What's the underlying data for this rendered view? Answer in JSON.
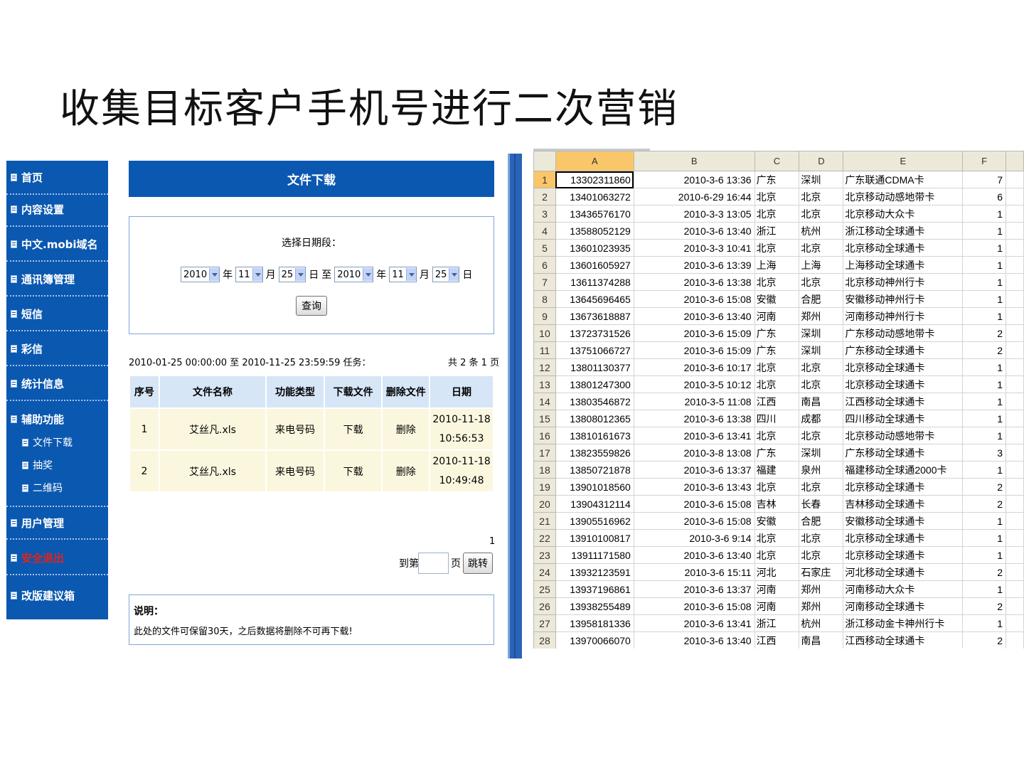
{
  "slide": {
    "title": "收集目标客户手机号进行二次营销"
  },
  "sidebar": {
    "items": [
      {
        "label": "首页"
      },
      {
        "label": "内容设置"
      },
      {
        "label": "中文.mobi域名"
      },
      {
        "label": "通讯簿管理"
      },
      {
        "label": "短信"
      },
      {
        "label": "彩信"
      },
      {
        "label": "统计信息"
      },
      {
        "label": "辅助功能"
      },
      {
        "label": "用户管理"
      },
      {
        "label": "安全退出"
      },
      {
        "label": "改版建议箱"
      }
    ],
    "sub_items": [
      {
        "label": "文件下载"
      },
      {
        "label": "抽奖"
      },
      {
        "label": "二维码"
      }
    ]
  },
  "content": {
    "header": "文件下载",
    "date_label": "选择日期段：",
    "from": {
      "year": "2010",
      "month": "11",
      "day": "25"
    },
    "to": {
      "year": "2010",
      "month": "11",
      "day": "25"
    },
    "unit_year": "年",
    "unit_month": "月",
    "unit_day": "日",
    "to_label": "至",
    "query_button": "查询",
    "range_text": "2010-01-25 00:00:00 至 2010-11-25 23:59:59 任务：",
    "total_text": "共 2 条 1 页",
    "table": {
      "headers": [
        "序号",
        "文件名称",
        "功能类型",
        "下载文件",
        "删除文件",
        "日期"
      ],
      "rows": [
        {
          "index": "1",
          "name": "艾丝凡.xls",
          "type": "来电号码",
          "download": "下载",
          "delete": "删除",
          "date": "2010-11-18",
          "time": "10:56:53"
        },
        {
          "index": "2",
          "name": "艾丝凡.xls",
          "type": "来电号码",
          "download": "下载",
          "delete": "删除",
          "date": "2010-11-18",
          "time": "10:49:48"
        }
      ]
    },
    "page_number": "1",
    "goto_label": "到第",
    "goto_page": "页",
    "goto_button": "跳转",
    "note_title": "说明：",
    "note_text": "此处的文件可保留30天，之后数据将删除不可再下载!"
  },
  "sheet": {
    "columns": [
      "A",
      "B",
      "C",
      "D",
      "E",
      "F"
    ],
    "rows": [
      [
        "1",
        "13302311860",
        "2010-3-6 13:36",
        "广东",
        "深圳",
        "广东联通CDMA卡",
        "7"
      ],
      [
        "2",
        "13401063272",
        "2010-6-29 16:44",
        "北京",
        "北京",
        "北京移动动感地带卡",
        "6"
      ],
      [
        "3",
        "13436576170",
        "2010-3-3 13:05",
        "北京",
        "北京",
        "北京移动大众卡",
        "1"
      ],
      [
        "4",
        "13588052129",
        "2010-3-6 13:40",
        "浙江",
        "杭州",
        "浙江移动全球通卡",
        "1"
      ],
      [
        "5",
        "13601023935",
        "2010-3-3 10:41",
        "北京",
        "北京",
        "北京移动全球通卡",
        "1"
      ],
      [
        "6",
        "13601605927",
        "2010-3-6 13:39",
        "上海",
        "上海",
        "上海移动全球通卡",
        "1"
      ],
      [
        "7",
        "13611374288",
        "2010-3-6 13:38",
        "北京",
        "北京",
        "北京移动神州行卡",
        "1"
      ],
      [
        "8",
        "13645696465",
        "2010-3-6 15:08",
        "安徽",
        "合肥",
        "安徽移动神州行卡",
        "1"
      ],
      [
        "9",
        "13673618887",
        "2010-3-6 13:40",
        "河南",
        "郑州",
        "河南移动神州行卡",
        "1"
      ],
      [
        "10",
        "13723731526",
        "2010-3-6 15:09",
        "广东",
        "深圳",
        "广东移动动感地带卡",
        "2"
      ],
      [
        "11",
        "13751066727",
        "2010-3-6 15:09",
        "广东",
        "深圳",
        "广东移动全球通卡",
        "2"
      ],
      [
        "12",
        "13801130377",
        "2010-3-6 10:17",
        "北京",
        "北京",
        "北京移动全球通卡",
        "1"
      ],
      [
        "13",
        "13801247300",
        "2010-3-5 10:12",
        "北京",
        "北京",
        "北京移动全球通卡",
        "1"
      ],
      [
        "14",
        "13803546872",
        "2010-3-5 11:08",
        "江西",
        "南昌",
        "江西移动全球通卡",
        "1"
      ],
      [
        "15",
        "13808012365",
        "2010-3-6 13:38",
        "四川",
        "成都",
        "四川移动全球通卡",
        "1"
      ],
      [
        "16",
        "13810161673",
        "2010-3-6 13:41",
        "北京",
        "北京",
        "北京移动动感地带卡",
        "1"
      ],
      [
        "17",
        "13823559826",
        "2010-3-8 13:08",
        "广东",
        "深圳",
        "广东移动全球通卡",
        "3"
      ],
      [
        "18",
        "13850721878",
        "2010-3-6 13:37",
        "福建",
        "泉州",
        "福建移动全球通2000卡",
        "1"
      ],
      [
        "19",
        "13901018560",
        "2010-3-6 13:43",
        "北京",
        "北京",
        "北京移动全球通卡",
        "2"
      ],
      [
        "20",
        "13904312114",
        "2010-3-6 15:08",
        "吉林",
        "长春",
        "吉林移动全球通卡",
        "2"
      ],
      [
        "21",
        "13905516962",
        "2010-3-6 15:08",
        "安徽",
        "合肥",
        "安徽移动全球通卡",
        "1"
      ],
      [
        "22",
        "13910100817",
        "2010-3-6 9:14",
        "北京",
        "北京",
        "北京移动全球通卡",
        "1"
      ],
      [
        "23",
        "13911171580",
        "2010-3-6 13:40",
        "北京",
        "北京",
        "北京移动全球通卡",
        "1"
      ],
      [
        "24",
        "13932123591",
        "2010-3-6 15:11",
        "河北",
        "石家庄",
        "河北移动全球通卡",
        "2"
      ],
      [
        "25",
        "13937196861",
        "2010-3-6 13:37",
        "河南",
        "郑州",
        "河南移动大众卡",
        "1"
      ],
      [
        "26",
        "13938255489",
        "2010-3-6 15:08",
        "河南",
        "郑州",
        "河南移动全球通卡",
        "2"
      ],
      [
        "27",
        "13958181336",
        "2010-3-6 13:41",
        "浙江",
        "杭州",
        "浙江移动金卡神州行卡",
        "1"
      ],
      [
        "28",
        "13970066070",
        "2010-3-6 13:40",
        "江西",
        "南昌",
        "江西移动全球通卡",
        "2"
      ]
    ]
  },
  "colors": {
    "nav_blue": "#0b58b0",
    "active_red": "#e2231a",
    "table_header": "#d6e6f7",
    "table_row": "#fbf7df",
    "sheet_header": "#ece9d8",
    "sheet_selected": "#f9c66a"
  },
  "icons": {
    "nav_item": "document-icon"
  }
}
